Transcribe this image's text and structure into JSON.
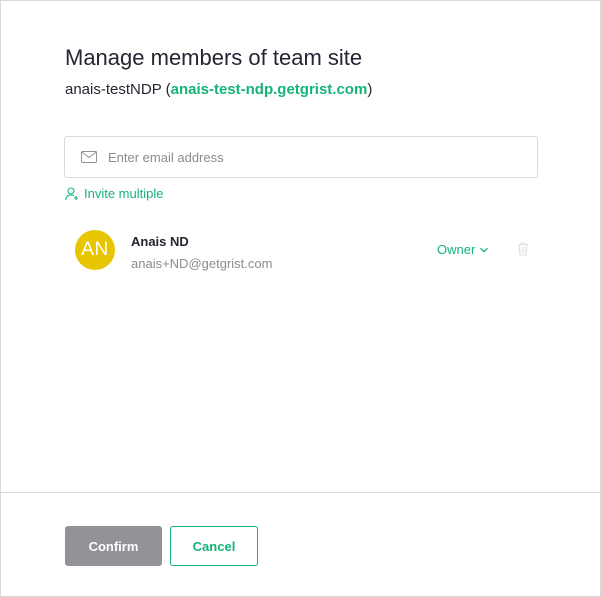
{
  "dialog": {
    "title": "Manage members of team site",
    "team_name": "anais-testNDP",
    "paren_open": " (",
    "team_domain": "anais-test-ndp.getgrist.com",
    "paren_close": ")"
  },
  "email_input": {
    "placeholder": "Enter email address",
    "value": "",
    "icon": "mail-icon"
  },
  "invite_multiple": {
    "label": "Invite multiple",
    "icon": "add-user-icon"
  },
  "members": [
    {
      "initials": "AN",
      "name": "Anais ND",
      "email": "anais+ND@getgrist.com",
      "role": "Owner",
      "avatar_color": "#e7c500"
    }
  ],
  "footer": {
    "confirm_label": "Confirm",
    "cancel_label": "Cancel"
  },
  "colors": {
    "accent": "#16b378",
    "confirm_disabled": "#929299",
    "muted_text": "#8c8c8c",
    "border": "#d9d9d9"
  }
}
